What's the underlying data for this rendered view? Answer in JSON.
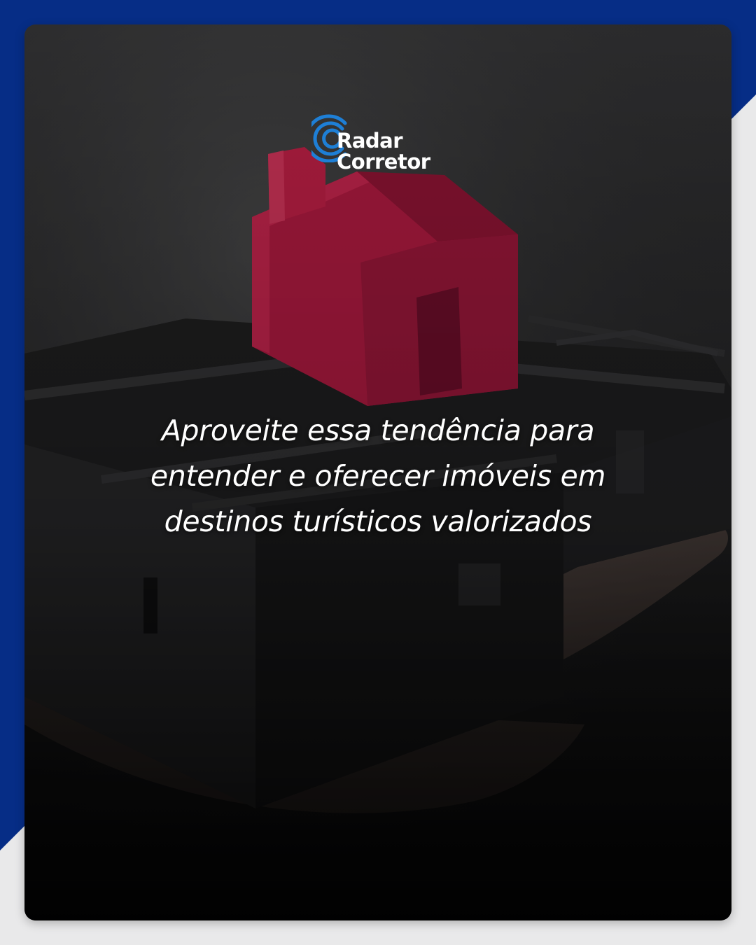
{
  "brand": {
    "logo_line1": "Radar",
    "logo_line2": "Corretor",
    "accent": "#1e7fd6",
    "navy": "#062d86"
  },
  "headline": {
    "lines": [
      "Aproveite essa tendência para",
      "entender e oferecer imóveis em",
      "destinos turísticos valorizados"
    ]
  },
  "image": {
    "subject": "house-model-in-hand",
    "house_color": "#c81e4a"
  }
}
